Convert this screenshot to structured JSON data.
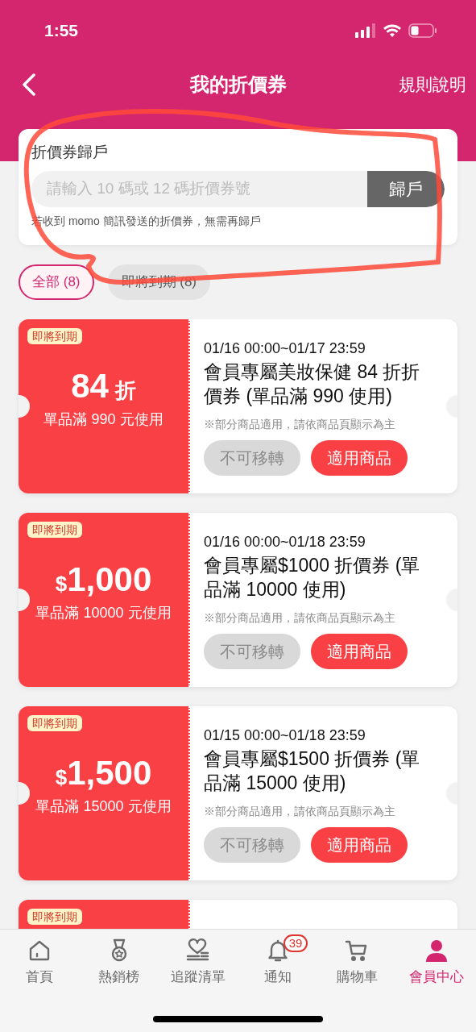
{
  "status_bar": {
    "time": "1:55"
  },
  "header": {
    "title": "我的折價券",
    "rules_link": "規則說明"
  },
  "redeem": {
    "title": "折價券歸戶",
    "placeholder": "請輸入 10 碼或 12 碼折價券號",
    "button": "歸戶",
    "hint": "若收到 momo 簡訊發送的折價券，無需再歸戶"
  },
  "filters": [
    {
      "label": "全部 (8)",
      "selected": true
    },
    {
      "label": "即將到期 (8)",
      "selected": false
    }
  ],
  "coupons": [
    {
      "badge": "即將到期",
      "kind": "percent",
      "value": "84",
      "unit": "折",
      "condition": "單品滿 990 元使用",
      "period": "01/16 00:00~01/17 23:59",
      "title": "會員專屬美妝保健 84 折折價券 (單品滿 990 使用)",
      "note": "※部分商品適用，請依商品頁顯示為主",
      "buttons": [
        {
          "label": "不可移轉",
          "disabled": true
        },
        {
          "label": "適用商品",
          "disabled": false
        }
      ]
    },
    {
      "badge": "即將到期",
      "kind": "amount",
      "value": "1,000",
      "unit": "$",
      "condition": "單品滿 10000 元使用",
      "period": "01/16 00:00~01/18 23:59",
      "title": "會員專屬$1000 折價券 (單品滿 10000 使用)",
      "note": "※部分商品適用，請依商品頁顯示為主",
      "buttons": [
        {
          "label": "不可移轉",
          "disabled": true
        },
        {
          "label": "適用商品",
          "disabled": false
        }
      ]
    },
    {
      "badge": "即將到期",
      "kind": "amount",
      "value": "1,500",
      "unit": "$",
      "condition": "單品滿 15000 元使用",
      "period": "01/15 00:00~01/18 23:59",
      "title": "會員專屬$1500 折價券 (單品滿 15000 使用)",
      "note": "※部分商品適用，請依商品頁顯示為主",
      "buttons": [
        {
          "label": "不可移轉",
          "disabled": true
        },
        {
          "label": "適用商品",
          "disabled": false
        }
      ]
    },
    {
      "badge": "即將到期",
      "kind": "partial"
    }
  ],
  "tab_bar": [
    {
      "label": "首頁",
      "kind": "home",
      "selected": false
    },
    {
      "label": "熱銷榜",
      "kind": "ranking",
      "selected": false
    },
    {
      "label": "追蹤清單",
      "kind": "wishlist",
      "selected": false
    },
    {
      "label": "通知",
      "kind": "notice",
      "selected": false,
      "badge": "39"
    },
    {
      "label": "購物車",
      "kind": "cart",
      "selected": false
    },
    {
      "label": "會員中心",
      "kind": "member",
      "selected": true
    }
  ]
}
